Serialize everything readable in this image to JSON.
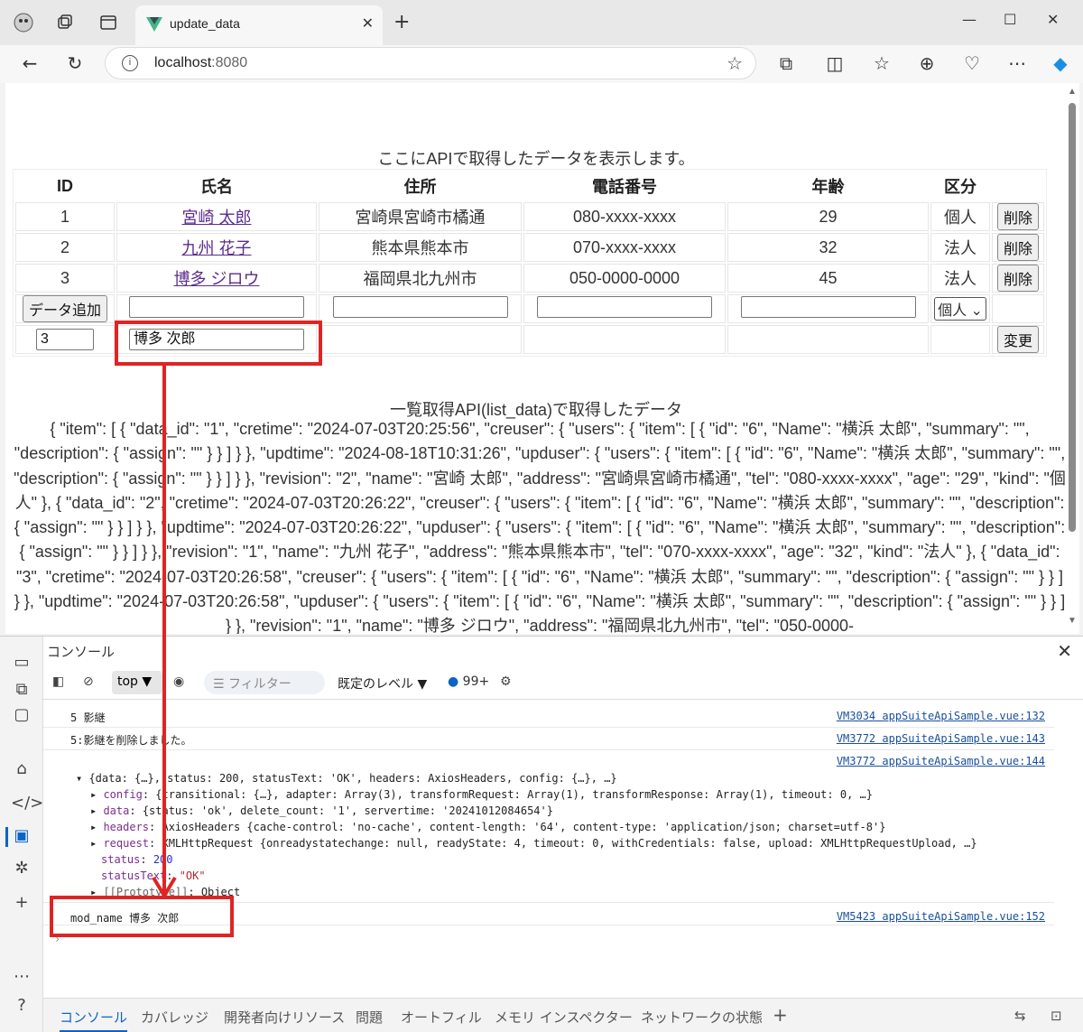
{
  "browser": {
    "tab_title": "update_data",
    "url_host": "localhost",
    "url_port": ":8080"
  },
  "page": {
    "heading": "ここにAPIで取得したデータを表示します。",
    "table": {
      "headers": [
        "ID",
        "氏名",
        "住所",
        "電話番号",
        "年齢",
        "区分"
      ],
      "rows": [
        {
          "id": "1",
          "name": "宮崎 太郎",
          "address": "宮崎県宮崎市橘通",
          "tel": "080-xxxx-xxxx",
          "age": "29",
          "kind": "個人",
          "delete_label": "削除"
        },
        {
          "id": "2",
          "name": "九州 花子",
          "address": "熊本県熊本市",
          "tel": "070-xxxx-xxxx",
          "age": "32",
          "kind": "法人",
          "delete_label": "削除"
        },
        {
          "id": "3",
          "name": "博多 ジロウ",
          "address": "福岡県北九州市",
          "tel": "050-0000-0000",
          "age": "45",
          "kind": "法人",
          "delete_label": "削除"
        }
      ],
      "add_label": "データ追加",
      "kind_select_value": "個人",
      "edit_id_value": "3",
      "edit_name_value": "博多 次郎",
      "change_label": "変更"
    },
    "list_heading": "一覧取得API(list_data)で取得したデータ",
    "json_text": "{ \"item\": [ { \"data_id\": \"1\", \"cretime\": \"2024-07-03T20:25:56\", \"creuser\": { \"users\": { \"item\": [ { \"id\": \"6\", \"Name\": \"横浜 太郎\", \"summary\": \"\", \"description\": { \"assign\": \"\" } } ] } }, \"updtime\": \"2024-08-18T10:31:26\", \"upduser\": { \"users\": { \"item\": [ { \"id\": \"6\", \"Name\": \"横浜 太郎\", \"summary\": \"\", \"description\": { \"assign\": \"\" } } ] } }, \"revision\": \"2\", \"name\": \"宮崎 太郎\", \"address\": \"宮崎県宮崎市橘通\", \"tel\": \"080-xxxx-xxxx\", \"age\": \"29\", \"kind\": \"個人\" }, { \"data_id\": \"2\", \"cretime\": \"2024-07-03T20:26:22\", \"creuser\": { \"users\": { \"item\": [ { \"id\": \"6\", \"Name\": \"横浜 太郎\", \"summary\": \"\", \"description\": { \"assign\": \"\" } } ] } }, \"updtime\": \"2024-07-03T20:26:22\", \"upduser\": { \"users\": { \"item\": [ { \"id\": \"6\", \"Name\": \"横浜 太郎\", \"summary\": \"\", \"description\": { \"assign\": \"\" } } ] } }, \"revision\": \"1\", \"name\": \"九州 花子\", \"address\": \"熊本県熊本市\", \"tel\": \"070-xxxx-xxxx\", \"age\": \"32\", \"kind\": \"法人\" }, { \"data_id\": \"3\", \"cretime\": \"2024-07-03T20:26:58\", \"creuser\": { \"users\": { \"item\": [ { \"id\": \"6\", \"Name\": \"横浜 太郎\", \"summary\": \"\", \"description\": { \"assign\": \"\" } } ] } }, \"updtime\": \"2024-07-03T20:26:58\", \"upduser\": { \"users\": { \"item\": [ { \"id\": \"6\", \"Name\": \"横浜 太郎\", \"summary\": \"\", \"description\": { \"assign\": \"\" } } ] } }, \"revision\": \"1\", \"name\": \"博多 ジロウ\", \"address\": \"福岡県北九州市\", \"tel\": \"050-0000-"
  },
  "devtools": {
    "title": "コンソール",
    "context": "top",
    "filter_placeholder": "フィルター",
    "level": "既定のレベル",
    "issues_count": "99+",
    "logs": [
      {
        "msg": "5 影継",
        "src": "VM3034 appSuiteApiSample.vue:132"
      },
      {
        "msg": "5:影継を削除しました。",
        "src": "VM3772 appSuiteApiSample.vue:143"
      },
      {
        "msg": "",
        "src": "VM3772 appSuiteApiSample.vue:144"
      },
      {
        "msg": "mod_name 博多 次郎",
        "src": "VM5423 appSuiteApiSample.vue:152"
      }
    ],
    "object_summary": "{data: {…}, status: 200, statusText: 'OK', headers: AxiosHeaders, config: {…}, …}",
    "object_lines": {
      "config": "{transitional: {…}, adapter: Array(3), transformRequest: Array(1), transformResponse: Array(1), timeout: 0, …}",
      "data": "{status: 'ok', delete_count: '1', servertime: '20241012084654'}",
      "headers": "AxiosHeaders {cache-control: 'no-cache', content-length: '64', content-type: 'application/json; charset=utf-8'}",
      "request": "XMLHttpRequest {onreadystatechange: null, readyState: 4, timeout: 0, withCredentials: false, upload: XMLHttpRequestUpload, …}",
      "status": "200",
      "statusText": "\"OK\"",
      "prototype": "Object"
    },
    "bottom_tabs": [
      "コンソール",
      "カバレッジ",
      "開発者向けリソース",
      "問題",
      "オートフィル",
      "メモリ インスペクター",
      "ネットワークの状態"
    ]
  },
  "colors": {
    "annotation": "#e02424",
    "link": "#5b2c8c",
    "accent": "#0a64c8"
  }
}
